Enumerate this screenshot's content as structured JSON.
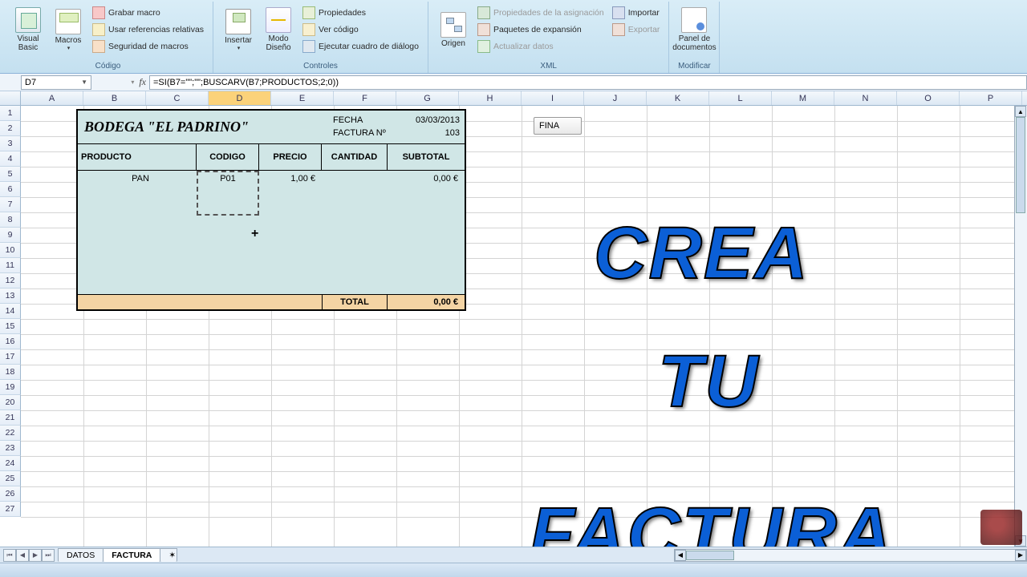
{
  "ribbon": {
    "groups": {
      "codigo": {
        "label": "Código",
        "visual_basic": "Visual\nBasic",
        "macros": "Macros",
        "grabar": "Grabar macro",
        "referencias": "Usar referencias relativas",
        "seguridad": "Seguridad de macros"
      },
      "controles": {
        "label": "Controles",
        "insertar": "Insertar",
        "modo": "Modo\nDiseño",
        "propiedades": "Propiedades",
        "ver_codigo": "Ver código",
        "ejecutar": "Ejecutar cuadro de diálogo"
      },
      "xml": {
        "label": "XML",
        "origen": "Origen",
        "asignacion": "Propiedades de la asignación",
        "expansion": "Paquetes de expansión",
        "actualizar": "Actualizar datos",
        "importar": "Importar",
        "exportar": "Exportar"
      },
      "modificar": {
        "label": "Modificar",
        "panel": "Panel de\ndocumentos"
      }
    }
  },
  "namebox": "D7",
  "formula": "=SI(B7=\"\";\"\";BUSCARV(B7;PRODUCTOS;2;0))",
  "columns": [
    "A",
    "B",
    "C",
    "D",
    "E",
    "F",
    "G",
    "H",
    "I",
    "J",
    "K",
    "L",
    "M",
    "N",
    "O",
    "P"
  ],
  "selected_col": "D",
  "row_count": 27,
  "invoice": {
    "title": "BODEGA \"EL PADRINO\"",
    "fecha_label": "FECHA",
    "fecha_value": "03/03/2013",
    "num_label": "FACTURA Nº",
    "num_value": "103",
    "hdr_producto": "PRODUCTO",
    "hdr_codigo": "CODIGO",
    "hdr_precio": "PRECIO",
    "hdr_cantidad": "CANTIDAD",
    "hdr_subtotal": "SUBTOTAL",
    "row_producto": "PAN",
    "row_codigo": "P01",
    "row_precio": "1,00 €",
    "row_subtotal": "0,00 €",
    "total_label": "TOTAL",
    "total_value": "0,00 €"
  },
  "button_finalizar": "FINA",
  "overlay": {
    "l1": "CREA",
    "l2": "TU",
    "l3": "FACTURA"
  },
  "tabs": {
    "t1": "DATOS",
    "t2": "FACTURA"
  }
}
